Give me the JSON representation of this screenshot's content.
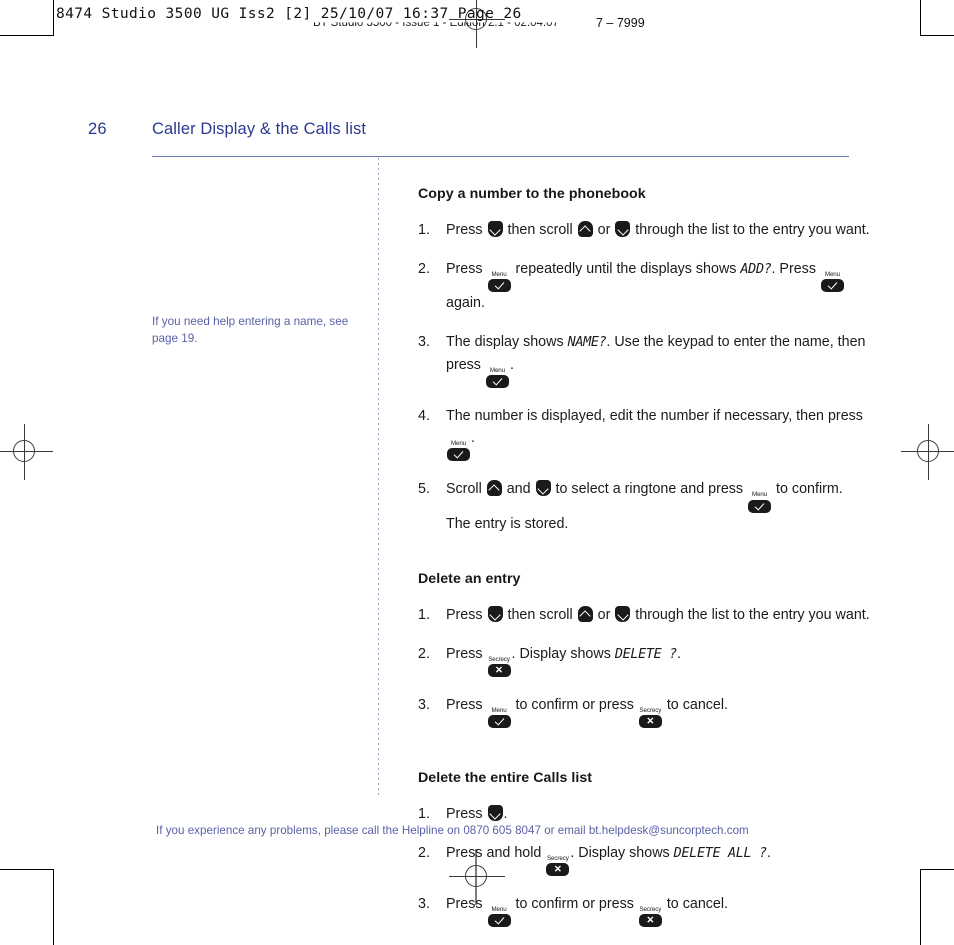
{
  "print_marks": {
    "slug_line_1": "8474 Studio 3500 UG Iss2 [2]  25/10/07  16:37  Page 26",
    "slug_line_2": "BT Studio 3500 - Issue 1 - Edition 2.1 - 02.04.07",
    "slug_line_2_tail": "7 – 7999"
  },
  "header": {
    "page_number": "26",
    "page_title": "Caller Display & the Calls list"
  },
  "margin_note": {
    "text": "If you need help entering a name, see page 19."
  },
  "sections": [
    {
      "heading": "Copy a number to the phonebook",
      "steps": [
        {
          "number": "1.",
          "parts": [
            {
              "type": "text",
              "value": "Press "
            },
            {
              "type": "key-nav-down"
            },
            {
              "type": "text",
              "value": " then scroll "
            },
            {
              "type": "key-nav-up"
            },
            {
              "type": "text",
              "value": " or "
            },
            {
              "type": "key-nav-down"
            },
            {
              "type": "text",
              "value": " through the list to the entry you want."
            }
          ]
        },
        {
          "number": "2.",
          "parts": [
            {
              "type": "text",
              "value": "Press "
            },
            {
              "type": "key-menu"
            },
            {
              "type": "text",
              "value": "  repeatedly until the displays shows "
            },
            {
              "type": "lcd",
              "value": "ADD?"
            },
            {
              "type": "text",
              "value": ". Press "
            },
            {
              "type": "key-menu"
            },
            {
              "type": "text",
              "value": " again."
            }
          ]
        },
        {
          "number": "3.",
          "parts": [
            {
              "type": "text",
              "value": "The display shows "
            },
            {
              "type": "lcd",
              "value": "NAME?"
            },
            {
              "type": "text",
              "value": ". Use the keypad to enter the name, then press "
            },
            {
              "type": "key-menu"
            },
            {
              "type": "text",
              "value": "."
            }
          ]
        },
        {
          "number": "4.",
          "parts": [
            {
              "type": "text",
              "value": "The number is displayed, edit the number if necessary, then press "
            },
            {
              "type": "key-menu"
            },
            {
              "type": "text",
              "value": "."
            }
          ]
        },
        {
          "number": "5.",
          "parts": [
            {
              "type": "text",
              "value": "Scroll "
            },
            {
              "type": "key-nav-up"
            },
            {
              "type": "text",
              "value": " and "
            },
            {
              "type": "key-nav-down"
            },
            {
              "type": "text",
              "value": " to select a ringtone and press "
            },
            {
              "type": "key-menu"
            },
            {
              "type": "text",
              "value": " to confirm. The entry is stored."
            }
          ]
        }
      ]
    },
    {
      "heading": "Delete an entry",
      "steps": [
        {
          "number": "1.",
          "parts": [
            {
              "type": "text",
              "value": "Press "
            },
            {
              "type": "key-nav-down"
            },
            {
              "type": "text",
              "value": " then scroll "
            },
            {
              "type": "key-nav-up"
            },
            {
              "type": "text",
              "value": " or "
            },
            {
              "type": "key-nav-down"
            },
            {
              "type": "text",
              "value": " through the list to the entry you want."
            }
          ]
        },
        {
          "number": "2.",
          "parts": [
            {
              "type": "text",
              "value": "Press "
            },
            {
              "type": "key-secrecy"
            },
            {
              "type": "text",
              "value": ". Display shows "
            },
            {
              "type": "lcd",
              "value": "DELETE ?"
            },
            {
              "type": "text",
              "value": "."
            }
          ]
        },
        {
          "number": "3.",
          "parts": [
            {
              "type": "text",
              "value": "Press "
            },
            {
              "type": "key-menu"
            },
            {
              "type": "text",
              "value": " to confirm or press "
            },
            {
              "type": "key-secrecy"
            },
            {
              "type": "text",
              "value": " to cancel."
            }
          ]
        }
      ]
    },
    {
      "heading": "Delete the entire Calls list",
      "steps": [
        {
          "number": "1.",
          "parts": [
            {
              "type": "text",
              "value": "Press "
            },
            {
              "type": "key-nav-down"
            },
            {
              "type": "text",
              "value": "."
            }
          ]
        },
        {
          "number": "2.",
          "parts": [
            {
              "type": "text",
              "value": "Press and hold "
            },
            {
              "type": "key-secrecy"
            },
            {
              "type": "text",
              "value": ". Display shows "
            },
            {
              "type": "lcd",
              "value": "DELETE ALL ?"
            },
            {
              "type": "text",
              "value": "."
            }
          ]
        },
        {
          "number": "3.",
          "parts": [
            {
              "type": "text",
              "value": "Press "
            },
            {
              "type": "key-menu"
            },
            {
              "type": "text",
              "value": "  to confirm or press "
            },
            {
              "type": "key-secrecy"
            },
            {
              "type": "text",
              "value": " to cancel."
            }
          ]
        }
      ]
    }
  ],
  "key_labels": {
    "menu": "Menu",
    "secrecy": "Secrecy"
  },
  "footer": {
    "text": "If you experience any problems, please call the Helpline on 0870 605 8047 or email bt.helpdesk@suncorptech.com"
  },
  "colors": {
    "heading_blue": "#2b3a8f",
    "note_blue": "#5a61a8",
    "rule_blue": "#6d78b5",
    "key_black": "#1a1a1a"
  }
}
